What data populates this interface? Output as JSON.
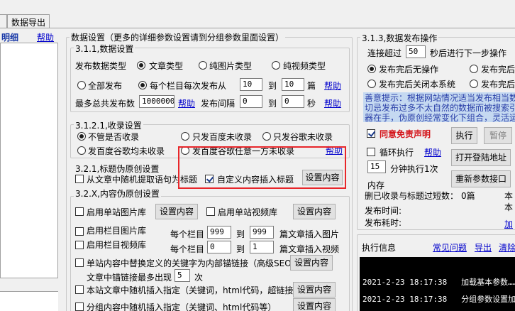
{
  "tabs": {
    "export": "数据导出"
  },
  "left": {
    "title": "明细",
    "help": "帮助"
  },
  "settings": {
    "title": "数据设置（更多的详细参数设置请到分组参数里面设置）",
    "s311": {
      "title": "3.1.1,数据设置",
      "type_label": "发布数据类型",
      "type_options": [
        "文章类型",
        "纯图片类型",
        "纯视频类型"
      ],
      "all_publish": "全部发布",
      "per_column_prefix": "每个栏目每次发布从",
      "per_from": "10",
      "to": "到",
      "per_to": "10",
      "unit": "篇",
      "help": "帮助",
      "max_label": "最多总共发布数",
      "max_value": "1000000",
      "interval_label": "发布间隔",
      "int_from": "0",
      "int_to": "0",
      "sec": "秒",
      "help2": "帮助",
      "help3": "帮助"
    },
    "s3121": {
      "title": "3.1.2.1,收录设置",
      "opt_any": "不管是否收录",
      "opt_baidu_no": "只发百度未收录",
      "opt_sogou_no": "只发谷歌未收录",
      "opt_both_no": "发百度谷歌均未收录",
      "opt_either_no": "发百度谷歌任意一方未收录",
      "help": "帮助"
    },
    "s321": {
      "title": "3.2.1,标题伪原创设置",
      "extract": "从文章中随机提取语句为标题",
      "custom_insert": "自定义内容插入标题",
      "btn": "设置内容"
    },
    "s32x": {
      "title": "3.2.X,内容伪原创设置",
      "site_img": "启用单站图片库",
      "btn1": "设置内容",
      "site_video": "启用单站视频库",
      "btn2": "设置内容",
      "col_img": "启用栏目图片库",
      "per_col": "每个栏目",
      "img_from": "999",
      "to": "到",
      "img_to": "999",
      "img_suffix": "篇文章插入图片",
      "col_video": "启用栏目视频库",
      "per_col2": "每个栏目",
      "vid_from": "0",
      "to2": "到",
      "vid_to": "1",
      "vid_suffix": "篇文章插入视频",
      "replace_kw": "单站内容中替换定义的关键字为内部锚链接（高级SEO）",
      "btn3": "设置内容",
      "anchor_max": "文章中锚链接最多出现",
      "anchor_num": "5",
      "anchor_unit": "次",
      "site_insert": "本站文章中随机插入指定（关键词，html代码，超链接等）",
      "btn4": "设置内容",
      "group_insert": "分组内容中随机插入指定（关键词、html代码等）",
      "btn5": "设置内容"
    }
  },
  "publish": {
    "title": "3.1.3,数据发布操作",
    "timeout_prefix": "连接超过",
    "timeout_value": "50",
    "timeout_suffix": "秒后进行下一步操作",
    "opt1": "发布完后无操作",
    "opt2": "发布完后",
    "opt3": "发布完后关闭本系统",
    "opt4": "发布完后",
    "hint_lines": [
      "善意提示：根据网站情况适当发布相当数",
      "切忌发布过多不太自然的数据而被搜索引",
      "器在手，伪原创经常变化下组合，灵活运用"
    ],
    "disclaimer": "同意免责声明",
    "run": "执行",
    "pause": "暂停",
    "loop": "循环执行",
    "help": "帮助",
    "open_login": "打开登陆地址",
    "interval_value": "15",
    "interval_suffix": "分钟执行1次",
    "reset_window": "重新参数接口",
    "memory": "内存",
    "deleted_label": "删已收录与标题过短数：",
    "deleted_value": "0篇",
    "r1": "本",
    "r2": "本",
    "time_label": "发布时间:",
    "cost_label": "发布耗时:",
    "plus": "加"
  },
  "exec": {
    "title": "执行信息",
    "faq": "常见问题",
    "export": "导出",
    "clear": "清除",
    "logs": [
      {
        "time": "2021-2-23 18:17:38",
        "msg": "加载基本参数……"
      },
      {
        "time": "2021-2-23 18:17:38",
        "msg": "分组参数设置加载完"
      }
    ]
  }
}
